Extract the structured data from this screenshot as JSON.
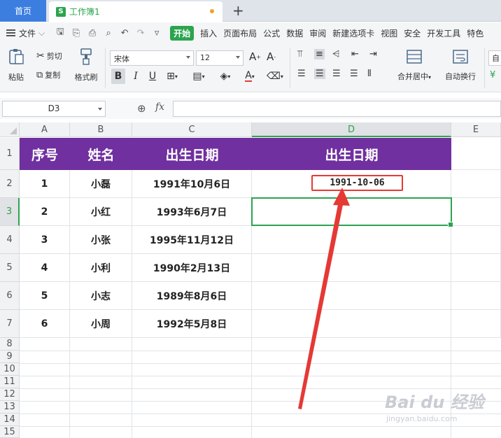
{
  "titlebar": {
    "home_tab": "首页",
    "doc_badge": "S",
    "doc_tab": "工作簿1",
    "add_tab": "+"
  },
  "menubar": {
    "file_label": "文件",
    "items": [
      "开始",
      "插入",
      "页面布局",
      "公式",
      "数据",
      "审阅",
      "新建选项卡",
      "视图",
      "安全",
      "开发工具",
      "特色"
    ],
    "active_item": "开始"
  },
  "ribbon": {
    "paste": "粘贴",
    "cut": "剪切",
    "copy": "复制",
    "format_painter": "格式刷",
    "font_name": "宋体",
    "font_size": "12",
    "bold": "B",
    "italic": "I",
    "underline": "U",
    "merge_center": "合并居中",
    "wrap_text": "自动换行",
    "auto_partial": "自"
  },
  "formula_bar": {
    "name_box": "D3",
    "fx": "fx",
    "formula": ""
  },
  "grid": {
    "columns": [
      "A",
      "B",
      "C",
      "D",
      "E"
    ],
    "rows": [
      "1",
      "2",
      "3",
      "4",
      "5",
      "6",
      "7",
      "8",
      "9",
      "10",
      "11",
      "12",
      "13",
      "14",
      "15"
    ],
    "selected_col": "D",
    "selected_row": "3",
    "header": [
      "序号",
      "姓名",
      "出生日期",
      "出生日期"
    ],
    "data": [
      [
        "1",
        "小磊",
        "1991年10月6日",
        "1991-10-06"
      ],
      [
        "2",
        "小红",
        "1993年6月7日",
        ""
      ],
      [
        "3",
        "小张",
        "1995年11月12日",
        ""
      ],
      [
        "4",
        "小利",
        "1990年2月13日",
        ""
      ],
      [
        "5",
        "小志",
        "1989年8月6日",
        ""
      ],
      [
        "6",
        "小周",
        "1992年5月8日",
        ""
      ]
    ]
  },
  "colors": {
    "header_fill": "#7030a0",
    "accent_green": "#2ba44f",
    "highlight_red": "#e53935",
    "home_tab_blue": "#3c7ee0"
  },
  "watermark": {
    "logo": "Bai du 经验",
    "url": "jingyan.baidu.com"
  }
}
